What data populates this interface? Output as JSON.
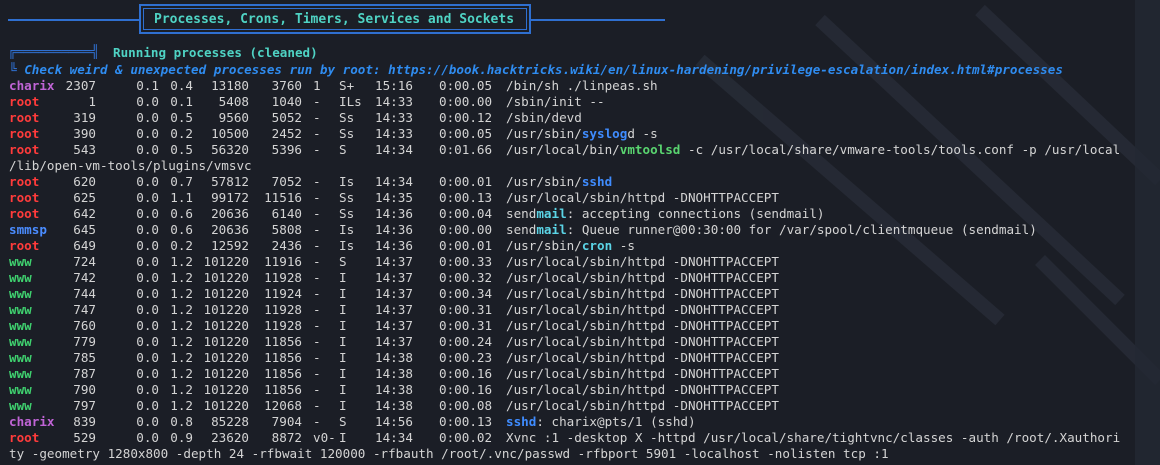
{
  "header": {
    "title": "Processes, Crons, Timers, Services and Sockets"
  },
  "section": {
    "title": "Running processes (cleaned)",
    "check_text": "Check weird & unexpected processes run by root: https://book.hacktricks.wiki/en/linux-hardening/privilege-escalation/index.html#processes",
    "bullet": "╚"
  },
  "processes": [
    {
      "user": "charix",
      "pid": "2307",
      "cpu": "0.1",
      "mem": "0.4",
      "vsz": "13180",
      "rss": "3760",
      "tt": "1",
      "stat": "S+",
      "start": "15:16",
      "time": "0:00.05",
      "cmd_pre": "/bin/sh ./linpeas.sh",
      "cmd_hl": "",
      "cmd_post": ""
    },
    {
      "user": "root",
      "pid": "1",
      "cpu": "0.0",
      "mem": "0.1",
      "vsz": "5408",
      "rss": "1040",
      "tt": "-",
      "stat": "ILs",
      "start": "14:33",
      "time": "0:00.00",
      "cmd_pre": "/sbin/init --",
      "cmd_hl": "",
      "cmd_post": ""
    },
    {
      "user": "root",
      "pid": "319",
      "cpu": "0.0",
      "mem": "0.5",
      "vsz": "9560",
      "rss": "5052",
      "tt": "-",
      "stat": "Ss",
      "start": "14:33",
      "time": "0:00.12",
      "cmd_pre": "/sbin/devd",
      "cmd_hl": "",
      "cmd_post": ""
    },
    {
      "user": "root",
      "pid": "390",
      "cpu": "0.0",
      "mem": "0.2",
      "vsz": "10500",
      "rss": "2452",
      "tt": "-",
      "stat": "Ss",
      "start": "14:33",
      "time": "0:00.05",
      "cmd_pre": "/usr/sbin/",
      "cmd_hl": "syslog",
      "cmd_post": "d -s"
    },
    {
      "user": "root",
      "pid": "543",
      "cpu": "0.0",
      "mem": "0.5",
      "vsz": "56320",
      "rss": "5396",
      "tt": "-",
      "stat": "S",
      "start": "14:34",
      "time": "0:01.66",
      "cmd_pre": "/usr/local/bin/",
      "cmd_hl": "vmtoolsd",
      "cmd_post": " -c /usr/local/share/vmware-tools/tools.conf -p /usr/local",
      "wrap": "/lib/open-vm-tools/plugins/vmsvc"
    },
    {
      "user": "root",
      "pid": "620",
      "cpu": "0.0",
      "mem": "0.7",
      "vsz": "57812",
      "rss": "7052",
      "tt": "-",
      "stat": "Is",
      "start": "14:34",
      "time": "0:00.01",
      "cmd_pre": "/usr/sbin/",
      "cmd_hl": "sshd",
      "cmd_post": ""
    },
    {
      "user": "root",
      "pid": "625",
      "cpu": "0.0",
      "mem": "1.1",
      "vsz": "99172",
      "rss": "11516",
      "tt": "-",
      "stat": "Ss",
      "start": "14:35",
      "time": "0:00.13",
      "cmd_pre": "/usr/local/sbin/httpd -DNOHTTPACCEPT",
      "cmd_hl": "",
      "cmd_post": ""
    },
    {
      "user": "root",
      "pid": "642",
      "cpu": "0.0",
      "mem": "0.6",
      "vsz": "20636",
      "rss": "6140",
      "tt": "-",
      "stat": "Ss",
      "start": "14:36",
      "time": "0:00.04",
      "cmd_pre": "send",
      "cmd_hl": "mail",
      "cmd_post": ": accepting connections (sendmail)"
    },
    {
      "user": "smmsp",
      "pid": "645",
      "cpu": "0.0",
      "mem": "0.6",
      "vsz": "20636",
      "rss": "5808",
      "tt": "-",
      "stat": "Is",
      "start": "14:36",
      "time": "0:00.00",
      "cmd_pre": "send",
      "cmd_hl": "mail",
      "cmd_post": ": Queue runner@00:30:00 for /var/spool/clientmqueue (sendmail)"
    },
    {
      "user": "root",
      "pid": "649",
      "cpu": "0.0",
      "mem": "0.2",
      "vsz": "12592",
      "rss": "2436",
      "tt": "-",
      "stat": "Is",
      "start": "14:36",
      "time": "0:00.01",
      "cmd_pre": "/usr/sbin/",
      "cmd_hl": "cron",
      "cmd_post": " -s"
    },
    {
      "user": "www",
      "pid": "724",
      "cpu": "0.0",
      "mem": "1.2",
      "vsz": "101220",
      "rss": "11916",
      "tt": "-",
      "stat": "S",
      "start": "14:37",
      "time": "0:00.33",
      "cmd_pre": "/usr/local/sbin/httpd -DNOHTTPACCEPT",
      "cmd_hl": "",
      "cmd_post": ""
    },
    {
      "user": "www",
      "pid": "742",
      "cpu": "0.0",
      "mem": "1.2",
      "vsz": "101220",
      "rss": "11928",
      "tt": "-",
      "stat": "I",
      "start": "14:37",
      "time": "0:00.32",
      "cmd_pre": "/usr/local/sbin/httpd -DNOHTTPACCEPT",
      "cmd_hl": "",
      "cmd_post": ""
    },
    {
      "user": "www",
      "pid": "744",
      "cpu": "0.0",
      "mem": "1.2",
      "vsz": "101220",
      "rss": "11924",
      "tt": "-",
      "stat": "I",
      "start": "14:37",
      "time": "0:00.34",
      "cmd_pre": "/usr/local/sbin/httpd -DNOHTTPACCEPT",
      "cmd_hl": "",
      "cmd_post": ""
    },
    {
      "user": "www",
      "pid": "747",
      "cpu": "0.0",
      "mem": "1.2",
      "vsz": "101220",
      "rss": "11928",
      "tt": "-",
      "stat": "I",
      "start": "14:37",
      "time": "0:00.31",
      "cmd_pre": "/usr/local/sbin/httpd -DNOHTTPACCEPT",
      "cmd_hl": "",
      "cmd_post": ""
    },
    {
      "user": "www",
      "pid": "760",
      "cpu": "0.0",
      "mem": "1.2",
      "vsz": "101220",
      "rss": "11928",
      "tt": "-",
      "stat": "I",
      "start": "14:37",
      "time": "0:00.31",
      "cmd_pre": "/usr/local/sbin/httpd -DNOHTTPACCEPT",
      "cmd_hl": "",
      "cmd_post": ""
    },
    {
      "user": "www",
      "pid": "779",
      "cpu": "0.0",
      "mem": "1.2",
      "vsz": "101220",
      "rss": "11856",
      "tt": "-",
      "stat": "I",
      "start": "14:37",
      "time": "0:00.24",
      "cmd_pre": "/usr/local/sbin/httpd -DNOHTTPACCEPT",
      "cmd_hl": "",
      "cmd_post": ""
    },
    {
      "user": "www",
      "pid": "785",
      "cpu": "0.0",
      "mem": "1.2",
      "vsz": "101220",
      "rss": "11856",
      "tt": "-",
      "stat": "I",
      "start": "14:38",
      "time": "0:00.23",
      "cmd_pre": "/usr/local/sbin/httpd -DNOHTTPACCEPT",
      "cmd_hl": "",
      "cmd_post": ""
    },
    {
      "user": "www",
      "pid": "787",
      "cpu": "0.0",
      "mem": "1.2",
      "vsz": "101220",
      "rss": "11856",
      "tt": "-",
      "stat": "I",
      "start": "14:38",
      "time": "0:00.16",
      "cmd_pre": "/usr/local/sbin/httpd -DNOHTTPACCEPT",
      "cmd_hl": "",
      "cmd_post": ""
    },
    {
      "user": "www",
      "pid": "790",
      "cpu": "0.0",
      "mem": "1.2",
      "vsz": "101220",
      "rss": "11856",
      "tt": "-",
      "stat": "I",
      "start": "14:38",
      "time": "0:00.16",
      "cmd_pre": "/usr/local/sbin/httpd -DNOHTTPACCEPT",
      "cmd_hl": "",
      "cmd_post": ""
    },
    {
      "user": "www",
      "pid": "797",
      "cpu": "0.0",
      "mem": "1.2",
      "vsz": "101220",
      "rss": "12068",
      "tt": "-",
      "stat": "I",
      "start": "14:38",
      "time": "0:00.08",
      "cmd_pre": "/usr/local/sbin/httpd -DNOHTTPACCEPT",
      "cmd_hl": "",
      "cmd_post": ""
    },
    {
      "user": "charix",
      "pid": "839",
      "cpu": "0.0",
      "mem": "0.8",
      "vsz": "85228",
      "rss": "7904",
      "tt": "-",
      "stat": "S",
      "start": "14:56",
      "time": "0:00.13",
      "cmd_pre": "",
      "cmd_hl": "sshd",
      "cmd_post": ": charix@pts/1 (sshd)"
    },
    {
      "user": "root",
      "pid": "529",
      "cpu": "0.0",
      "mem": "0.9",
      "vsz": "23620",
      "rss": "8872",
      "tt": "v0-",
      "stat": "I",
      "start": "14:34",
      "time": "0:00.02",
      "cmd_pre": "Xvnc :1 -desktop X -httpd /usr/local/share/tightvnc/classes -auth /root/.Xauthori",
      "cmd_hl": "",
      "cmd_post": "",
      "wrap": "ty -geometry 1280x800 -depth 24 -rfbwait 120000 -rfbauth /root/.vnc/passwd -rfbport 5901 -localhost -nolisten tcp :1"
    }
  ],
  "colors": {
    "background": "#1b1e26",
    "header_border": "#2f6fd0",
    "header_text": "#4fd3c4",
    "charix": "#c064d6",
    "root": "#ff3b3b",
    "smmsp": "#4a8cff",
    "www": "#3fd16f"
  }
}
